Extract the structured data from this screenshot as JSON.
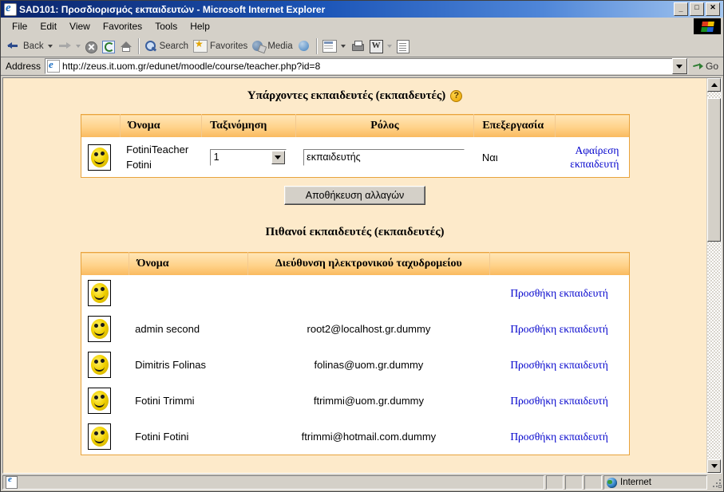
{
  "window": {
    "title": "SAD101: Προσδιορισμός εκπαιδευτών - Microsoft Internet Explorer",
    "minimize_label": "_",
    "maximize_label": "□",
    "close_label": "✕"
  },
  "menu": {
    "items": [
      {
        "label": "File"
      },
      {
        "label": "Edit"
      },
      {
        "label": "View"
      },
      {
        "label": "Favorites"
      },
      {
        "label": "Tools"
      },
      {
        "label": "Help"
      }
    ]
  },
  "toolbar": {
    "back_label": "Back",
    "search_label": "Search",
    "favorites_label": "Favorites",
    "media_label": "Media"
  },
  "address": {
    "label": "Address",
    "url": "http://zeus.it.uom.gr/edunet/moodle/course/teacher.php?id=8",
    "go_label": "Go"
  },
  "page": {
    "existing": {
      "title": "Υπάρχοντες εκπαιδευτές (εκπαιδευτές)",
      "help_glyph": "?",
      "columns": [
        "",
        "Όνομα",
        "Ταξινόμηση",
        "Ρόλος",
        "Επεξεργασία",
        ""
      ],
      "rows": [
        {
          "name": "FotiniTeacher Fotini",
          "name_line1": "FotiniTeacher",
          "name_line2": "Fotini",
          "order_value": "1",
          "role_value": "εκπαιδευτής",
          "editing": "Ναι",
          "action_line1": "Αφαίρεση",
          "action_line2": "εκπαιδευτή"
        }
      ],
      "save_label": "Αποθήκευση αλλαγών"
    },
    "potential": {
      "title": "Πιθανοί εκπαιδευτές (εκπαιδευτές)",
      "columns": [
        "",
        "Όνομα",
        "Διεύθυνση ηλεκτρονικού ταχυδρομείου",
        ""
      ],
      "rows": [
        {
          "name": "",
          "email": "",
          "action": "Προσθήκη εκπαιδευτή"
        },
        {
          "name": "admin second",
          "email": "root2@localhost.gr.dummy",
          "action": "Προσθήκη εκπαιδευτή"
        },
        {
          "name": "Dimitris Folinas",
          "email": "folinas@uom.gr.dummy",
          "action": "Προσθήκη εκπαιδευτή"
        },
        {
          "name": "Fotini Trimmi",
          "email": "ftrimmi@uom.gr.dummy",
          "action": "Προσθήκη εκπαιδευτή"
        },
        {
          "name": "Fotini Fotini",
          "email": "ftrimmi@hotmail.com.dummy",
          "action": "Προσθήκη εκπαιδευτή"
        }
      ]
    }
  },
  "status": {
    "message": "",
    "zone": "Internet"
  },
  "colors": {
    "page_background": "#fdeaca",
    "table_header_top": "#ffe6b8",
    "table_header_bottom": "#f9b95e",
    "table_border": "#e8a33d",
    "link": "#0000cc",
    "titlebar_start": "#0a246a"
  }
}
